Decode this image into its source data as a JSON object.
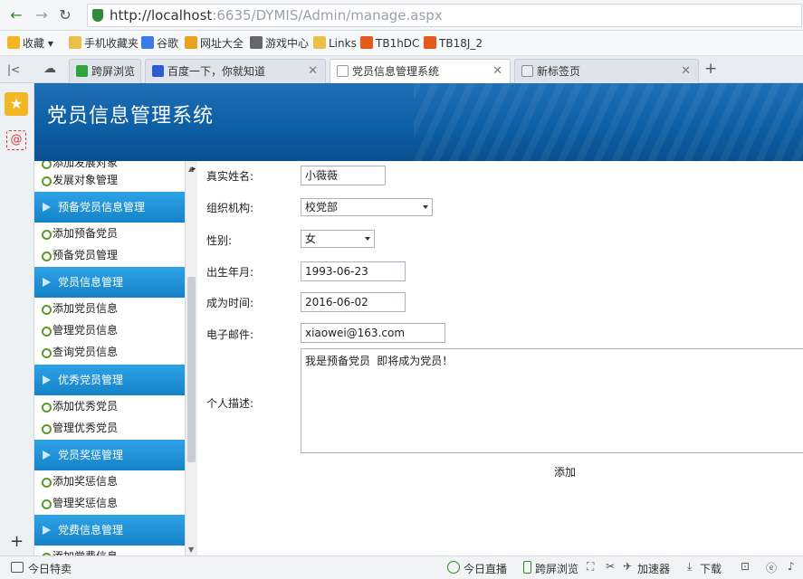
{
  "browser": {
    "url_host": "http://localhost",
    "url_rest": ":6635/DYMIS/Admin/manage.aspx",
    "favorites": [
      "收藏",
      "手机收藏夹",
      "谷歌",
      "网址大全",
      "游戏中心",
      "Links",
      "TB1hDC",
      "TB18J_2"
    ],
    "tabs": [
      {
        "label": "跨屏浏览"
      },
      {
        "label": "百度一下，你就知道"
      },
      {
        "label": "党员信息管理系统"
      },
      {
        "label": "新标签页"
      }
    ]
  },
  "app": {
    "title": "党员信息管理系统"
  },
  "menu": {
    "partial_top": "添加发展对象",
    "items_top": [
      "发展对象管理"
    ],
    "groups": [
      {
        "title": "预备党员信息管理",
        "items": [
          "添加预备党员",
          "预备党员管理"
        ]
      },
      {
        "title": "党员信息管理",
        "items": [
          "添加党员信息",
          "管理党员信息",
          "查询党员信息"
        ]
      },
      {
        "title": "优秀党员管理",
        "items": [
          "添加优秀党员",
          "管理优秀党员"
        ]
      },
      {
        "title": "党员奖惩管理",
        "items": [
          "添加奖惩信息",
          "管理奖惩信息"
        ]
      },
      {
        "title": "党费信息管理",
        "items": [
          "添加党费信息"
        ]
      }
    ]
  },
  "form": {
    "name_label": "真实姓名:",
    "name_value": "小薇薇",
    "org_label": "组织机构:",
    "org_value": "校党部",
    "gender_label": "性别:",
    "gender_value": "女",
    "birth_label": "出生年月:",
    "birth_value": "1993-06-23",
    "join_label": "成为时间:",
    "join_value": "2016-06-02",
    "email_label": "电子邮件:",
    "email_value": "xiaowei@163.com",
    "desc_label": "个人描述:",
    "desc_value": "我是预备党员 即将成为党员！",
    "submit_label": "添加"
  },
  "statusbar": {
    "left": "今日特卖",
    "items": [
      "今日直播",
      "跨屏浏览",
      "加速器",
      "下载"
    ]
  },
  "colors": {
    "header": "#0d5fa6",
    "menu_group": "#1a8fd6",
    "accent_green": "#2f8a2a"
  }
}
